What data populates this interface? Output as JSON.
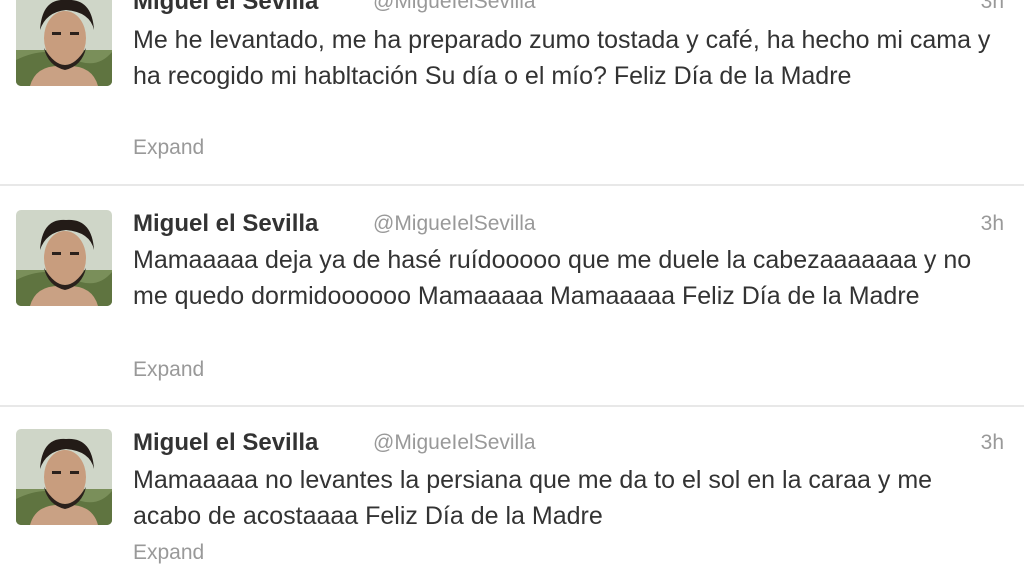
{
  "tweets": [
    {
      "name": "Miguel el Sevilla",
      "handle": "@MigueIelSevilla",
      "time": "3h",
      "text": "Me he levantado, me ha preparado zumo tostada y café, ha hecho mi cama y ha recogido mi habltación Su día o el mío? Feliz Día de la Madre",
      "expand": "Expand"
    },
    {
      "name": "Miguel el Sevilla",
      "handle": "@MigueIelSevilla",
      "time": "3h",
      "text": "Mamaaaaa deja ya de hasé ruídooooo que me duele la cabezaaaaaaa y no me quedo dormidoooooo Mamaaaaa Mamaaaaa Feliz Día de la Madre",
      "expand": "Expand"
    },
    {
      "name": "Miguel el Sevilla",
      "handle": "@MigueIelSevilla",
      "time": "3h",
      "text": "Mamaaaaa no levantes la persiana que me da to el sol en la caraa y me acabo de acostaaaa Feliz Día de la Madre",
      "expand": "Expand"
    }
  ],
  "colors": {
    "name": "#333333",
    "meta": "#999999",
    "divider": "#e8e8e8"
  }
}
